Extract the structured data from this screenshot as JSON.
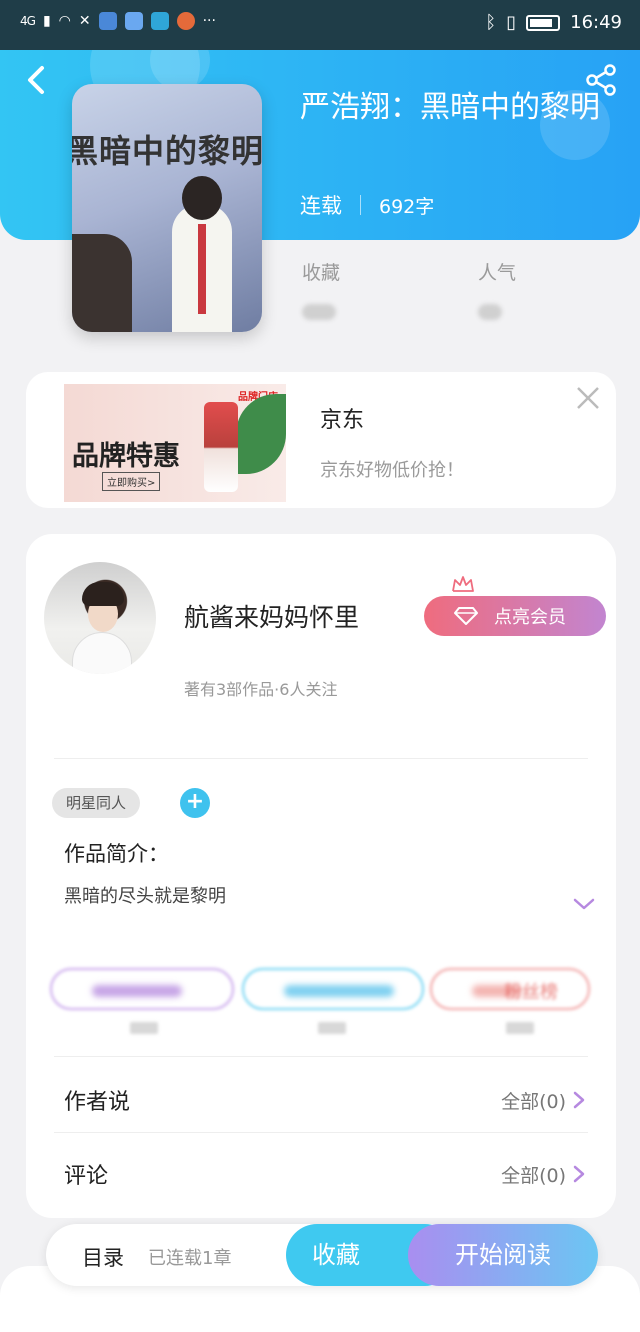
{
  "status_bar": {
    "network": "4G",
    "time": "16:49",
    "more": "···"
  },
  "header": {
    "book_title": "严浩翔：黑暗中的黎明",
    "status": "连载",
    "word_count": "692字",
    "stat_favorites_label": "收藏",
    "stat_popularity_label": "人气"
  },
  "cover": {
    "title_text": "黑暗中的黎明"
  },
  "ad": {
    "image_title": "品牌特惠",
    "image_button": "立即购买>",
    "image_brand": "品牌门店",
    "title": "京东",
    "desc": "京东好物低价抢！"
  },
  "author": {
    "name": "航酱来妈妈怀里",
    "sub": "著有3部作品·6人关注",
    "vip_button": "点亮会员"
  },
  "tags": [
    "明星同人"
  ],
  "intro": {
    "label": "作品简介：",
    "text": "黑暗的尽头就是黎明"
  },
  "pills": {
    "third_text": "粉丝榜"
  },
  "rows": [
    {
      "label": "作者说",
      "right": "全部(0)"
    },
    {
      "label": "评论",
      "right": "全部(0)"
    }
  ],
  "bottom": {
    "toc": "目录",
    "toc_count": "已连载1章",
    "favorite": "收藏",
    "read": "开始阅读"
  },
  "colors": {
    "header_gradient_start": "#33c5f3",
    "header_gradient_end": "#27a2f5",
    "vip_gradient_start": "#ef6c7e",
    "vip_gradient_end": "#c285d0",
    "accent_cyan": "#3fc9f0",
    "chevron_purple": "#b689e0"
  }
}
